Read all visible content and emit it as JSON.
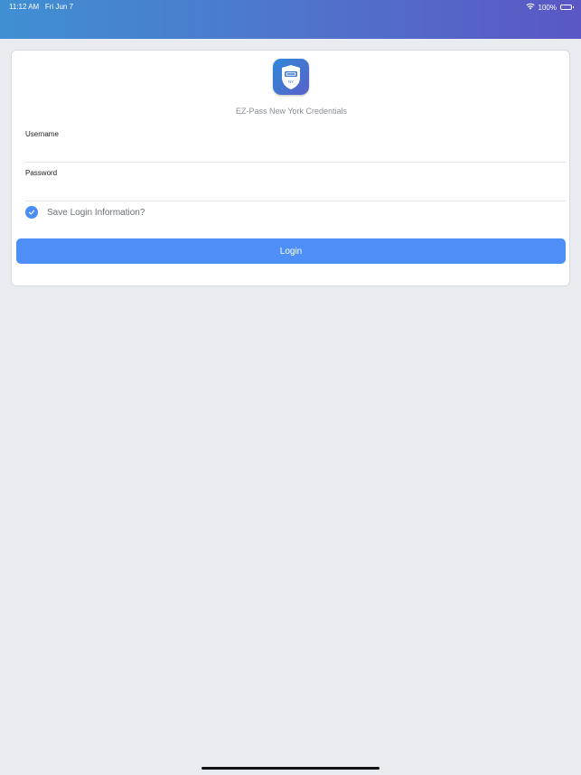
{
  "status_bar": {
    "time": "11:12 AM",
    "date": "Fri Jun 7",
    "battery": "100%"
  },
  "card": {
    "icon_text": "NY",
    "subtitle": "EZ-Pass New York Credentials",
    "username": {
      "label": "Username",
      "value": ""
    },
    "password": {
      "label": "Password",
      "value": ""
    },
    "save_login": {
      "label": "Save Login Information?",
      "checked": true
    },
    "login_button": "Login"
  },
  "colors": {
    "header_start": "#3f8fd3",
    "header_end": "#5a57c4",
    "accent": "#4d8ff6",
    "background": "#e8ebef"
  },
  "icons": [
    "wifi-icon",
    "battery-icon",
    "checkmark-icon",
    "app-icon"
  ]
}
